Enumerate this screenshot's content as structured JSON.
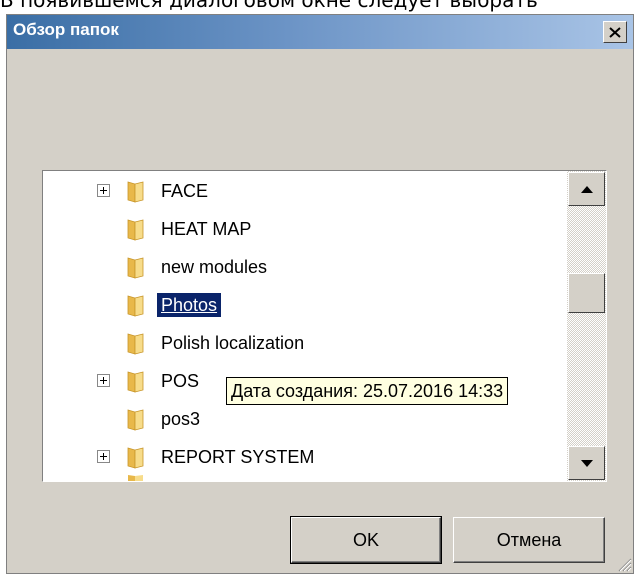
{
  "background_text": "В появившемся диалоговом окне следует выбрать",
  "dialog": {
    "title": "Обзор папок",
    "close_label": "X"
  },
  "tree": {
    "items": [
      {
        "label": "FACE",
        "expandable": true,
        "selected": false
      },
      {
        "label": "HEAT MAP",
        "expandable": false,
        "selected": false
      },
      {
        "label": "new modules",
        "expandable": false,
        "selected": false
      },
      {
        "label": "Photos",
        "expandable": false,
        "selected": true
      },
      {
        "label": "Polish localization",
        "expandable": false,
        "selected": false
      },
      {
        "label": "POS",
        "expandable": true,
        "selected": false
      },
      {
        "label": "pos3",
        "expandable": false,
        "selected": false
      },
      {
        "label": "REPORT SYSTEM",
        "expandable": true,
        "selected": false
      }
    ]
  },
  "tooltip": {
    "text": "Дата создания: 25.07.2016 14:33"
  },
  "buttons": {
    "ok_label": "OK",
    "cancel_label": "Отмена"
  },
  "colors": {
    "selection": "#0a246a",
    "tooltip_bg": "#ffffe1",
    "dialog_bg": "#d4d0c8",
    "folder": "#e8b84a"
  }
}
